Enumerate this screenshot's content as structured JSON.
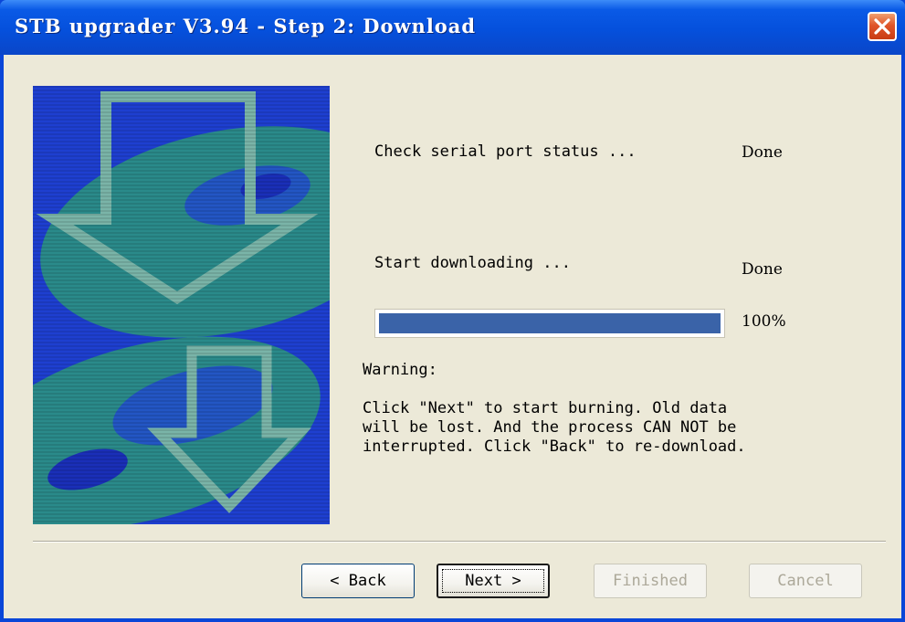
{
  "window": {
    "title": "STB upgrader V3.94 - Step 2: Download"
  },
  "steps": [
    {
      "label": "Check serial port status ...",
      "status": "Done"
    },
    {
      "label": "Start downloading ...",
      "status": "Done"
    }
  ],
  "progress": {
    "value": 1.0,
    "percent_label": "100%"
  },
  "warning": {
    "title": "Warning:",
    "lines": [
      "Click \"Next\" to start burning. Old data",
      "will be lost. And the process CAN NOT be",
      "interrupted. Click \"Back\" to re-download."
    ]
  },
  "buttons": {
    "back": "< Back",
    "next": "Next >",
    "finished": "Finished",
    "cancel": "Cancel"
  },
  "colors": {
    "titlebar": "#0550dc",
    "client_bg": "#ece9d8",
    "progress_fill": "#3a63a8",
    "banner_blue": "#1e3fd0",
    "banner_teal": "#2a8a8a",
    "banner_arrow": "#7ab4a8"
  },
  "icons": {
    "close": "close-x-icon",
    "banner": "download-arrow-icon"
  }
}
